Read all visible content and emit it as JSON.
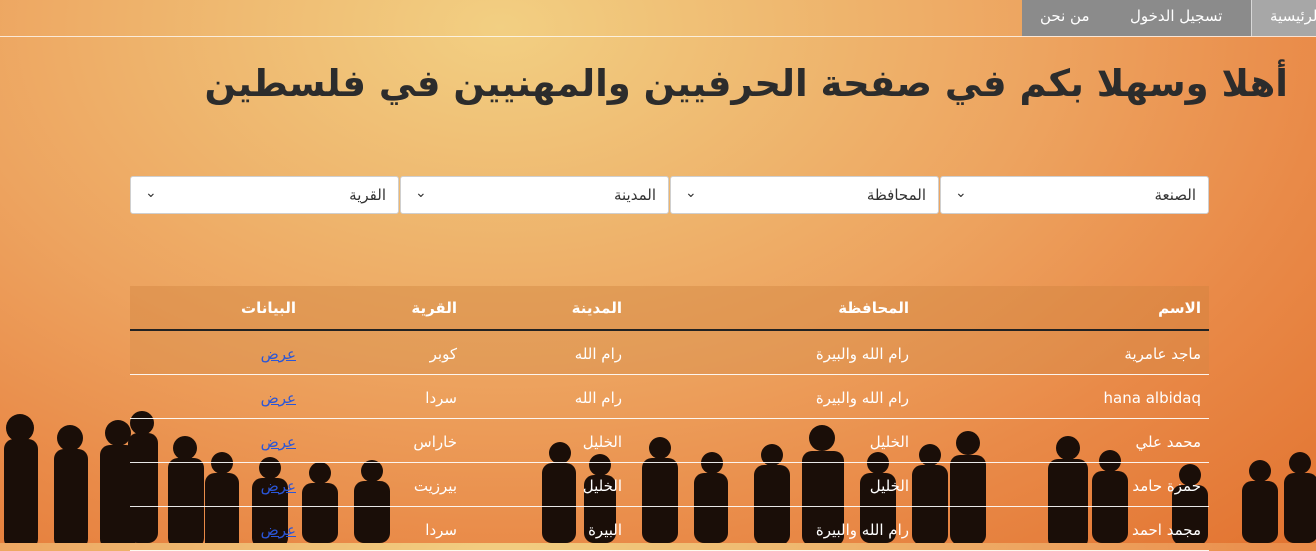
{
  "nav": {
    "home": "الرئيسية",
    "login": "تسجيل الدخول",
    "about": "من نحن"
  },
  "page_title": "أهلا وسهلا بكم في صفحة الحرفيين والمهنيين في فلسطين",
  "filters": {
    "craft": "الصنعة",
    "governorate": "المحافظة",
    "city": "المدينة",
    "village": "القرية"
  },
  "table": {
    "headers": {
      "name": "الاسم",
      "governorate": "المحافظة",
      "city": "المدينة",
      "village": "القرية",
      "data": "البيانات"
    },
    "rows": [
      {
        "name": "ماجد عامرية",
        "governorate": "رام الله والبيرة",
        "city": "رام الله",
        "village": "كوبر",
        "action": "عرض"
      },
      {
        "name": "hana albidaq",
        "governorate": "رام الله والبيرة",
        "city": "رام الله",
        "village": "سردا",
        "action": "عرض"
      },
      {
        "name": "محمد علي",
        "governorate": "الخليل",
        "city": "الخليل",
        "village": "خاراس",
        "action": "عرض"
      },
      {
        "name": "حمزة حامد",
        "governorate": "الخليل",
        "city": "الخليل",
        "village": "بيرزيت",
        "action": "عرض"
      },
      {
        "name": "مجمد احمد",
        "governorate": "رام الله والبيرة",
        "city": "البيرة",
        "village": "سردا",
        "action": "عرض"
      }
    ]
  },
  "colors": {
    "nav_bg": "#8b8b8b",
    "link": "#2a56d8",
    "title": "#2c2c2c"
  }
}
